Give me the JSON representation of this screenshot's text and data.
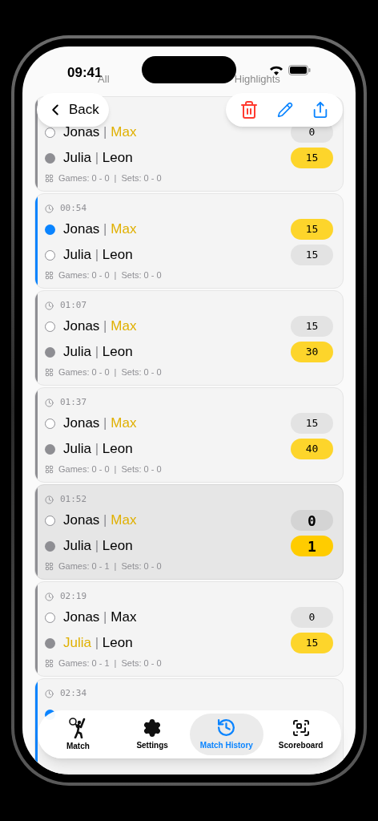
{
  "status_bar": {
    "time": "09:41"
  },
  "segments": [
    {
      "label": "All",
      "selected": false
    },
    {
      "label": "Highlights",
      "selected": false
    }
  ],
  "toolbar": {
    "back": "Back"
  },
  "points": [
    {
      "current": false,
      "selected": false,
      "games": "Games: 0 - 0",
      "divider": "|",
      "sets": "Sets: 0 - 0",
      "teams": [
        {
          "serving": false,
          "players": [
            {
              "name": "Jonas",
              "highlight": false
            },
            {
              "name": "Max",
              "highlight": true
            }
          ],
          "separator": "|",
          "score": "0",
          "winning": false
        },
        {
          "serving": true,
          "players": [
            {
              "name": "Julia",
              "highlight": false
            },
            {
              "name": "Leon",
              "highlight": false
            }
          ],
          "separator": "|",
          "score": "15",
          "winning": true
        }
      ]
    },
    {
      "time": "00:54",
      "current": true,
      "selected": false,
      "games": "Games: 0 - 0",
      "divider": "|",
      "sets": "Sets: 0 - 0",
      "teams": [
        {
          "serving": true,
          "players": [
            {
              "name": "Jonas",
              "highlight": false
            },
            {
              "name": "Max",
              "highlight": true
            }
          ],
          "separator": "|",
          "score": "15",
          "winning": true
        },
        {
          "serving": false,
          "players": [
            {
              "name": "Julia",
              "highlight": false
            },
            {
              "name": "Leon",
              "highlight": false
            }
          ],
          "separator": "|",
          "score": "15",
          "winning": false
        }
      ]
    },
    {
      "time": "01:07",
      "current": false,
      "selected": false,
      "games": "Games: 0 - 0",
      "divider": "|",
      "sets": "Sets: 0 - 0",
      "teams": [
        {
          "serving": false,
          "players": [
            {
              "name": "Jonas",
              "highlight": false
            },
            {
              "name": "Max",
              "highlight": true
            }
          ],
          "separator": "|",
          "score": "15",
          "winning": false
        },
        {
          "serving": true,
          "players": [
            {
              "name": "Julia",
              "highlight": false
            },
            {
              "name": "Leon",
              "highlight": false
            }
          ],
          "separator": "|",
          "score": "30",
          "winning": true
        }
      ]
    },
    {
      "time": "01:37",
      "current": false,
      "selected": false,
      "games": "Games: 0 - 0",
      "divider": "|",
      "sets": "Sets: 0 - 0",
      "teams": [
        {
          "serving": false,
          "players": [
            {
              "name": "Jonas",
              "highlight": false
            },
            {
              "name": "Max",
              "highlight": true
            }
          ],
          "separator": "|",
          "score": "15",
          "winning": false
        },
        {
          "serving": true,
          "players": [
            {
              "name": "Julia",
              "highlight": false
            },
            {
              "name": "Leon",
              "highlight": false
            }
          ],
          "separator": "|",
          "score": "40",
          "winning": true
        }
      ]
    },
    {
      "time": "01:52",
      "current": false,
      "selected": true,
      "games": "Games: 0 - 1",
      "divider": "|",
      "sets": "Sets: 0 - 0",
      "teams": [
        {
          "serving": false,
          "players": [
            {
              "name": "Jonas",
              "highlight": false
            },
            {
              "name": "Max",
              "highlight": true
            }
          ],
          "separator": "|",
          "score": "0",
          "winning": false
        },
        {
          "serving": true,
          "players": [
            {
              "name": "Julia",
              "highlight": false
            },
            {
              "name": "Leon",
              "highlight": false
            }
          ],
          "separator": "|",
          "score": "1",
          "winning": true
        }
      ]
    },
    {
      "time": "02:19",
      "current": false,
      "selected": false,
      "games": "Games: 0 - 1",
      "divider": "|",
      "sets": "Sets: 0 - 0",
      "teams": [
        {
          "serving": false,
          "players": [
            {
              "name": "Jonas",
              "highlight": false
            },
            {
              "name": "Max",
              "highlight": false
            }
          ],
          "separator": "|",
          "score": "0",
          "winning": false
        },
        {
          "serving": true,
          "players": [
            {
              "name": "Julia",
              "highlight": true
            },
            {
              "name": "Leon",
              "highlight": false
            }
          ],
          "separator": "|",
          "score": "15",
          "winning": true
        }
      ]
    },
    {
      "time": "02:34",
      "current": true,
      "selected": false,
      "teams": [
        {
          "serving": true
        }
      ]
    }
  ],
  "tabs": [
    {
      "kind": "match",
      "label": "Match",
      "selected": false
    },
    {
      "kind": "settings",
      "label": "Settings",
      "selected": false
    },
    {
      "kind": "history",
      "label": "Match History",
      "selected": true
    },
    {
      "kind": "scoreboard",
      "label": "Scoreboard",
      "selected": false
    }
  ]
}
